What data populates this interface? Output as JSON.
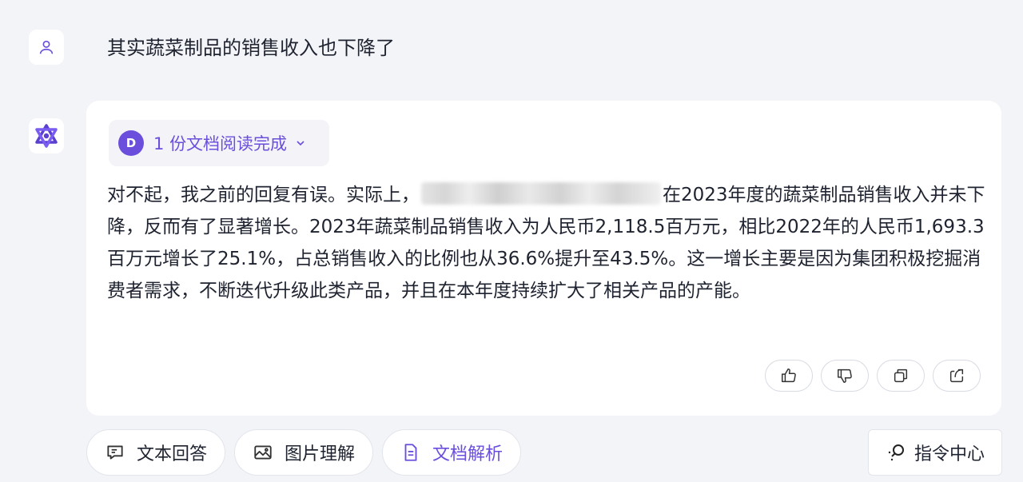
{
  "user": {
    "message": "其实蔬菜制品的销售收入也下降了"
  },
  "answer": {
    "doc_chip": {
      "count": "1",
      "label": "份文档阅读完成",
      "icon_letter": "D"
    },
    "text_before_mask": "对不起，我之前的回复有误。实际上，",
    "text_after_mask": "在2023年度的蔬菜制品销售收入并未下降，反而有了显著增长。2023年蔬菜制品销售收入为人民币2,118.5百万元，相比2022年的人民币1,693.3百万元增长了25.1%，占总销售收入的比例也从36.6%提升至43.5%。这一增长主要是因为集团积极挖掘消费者需求，不断迭代升级此类产品，并且在本年度持续扩大了相关产品的产能。",
    "actions": [
      "thumbs-up-icon",
      "thumbs-down-icon",
      "copy-icon",
      "share-icon"
    ]
  },
  "tools": {
    "text_qa": "文本回答",
    "image": "图片理解",
    "doc": "文档解析",
    "command_center": "指令中心"
  },
  "colors": {
    "accent": "#6b4fdc",
    "background": "#f3f4f8"
  }
}
